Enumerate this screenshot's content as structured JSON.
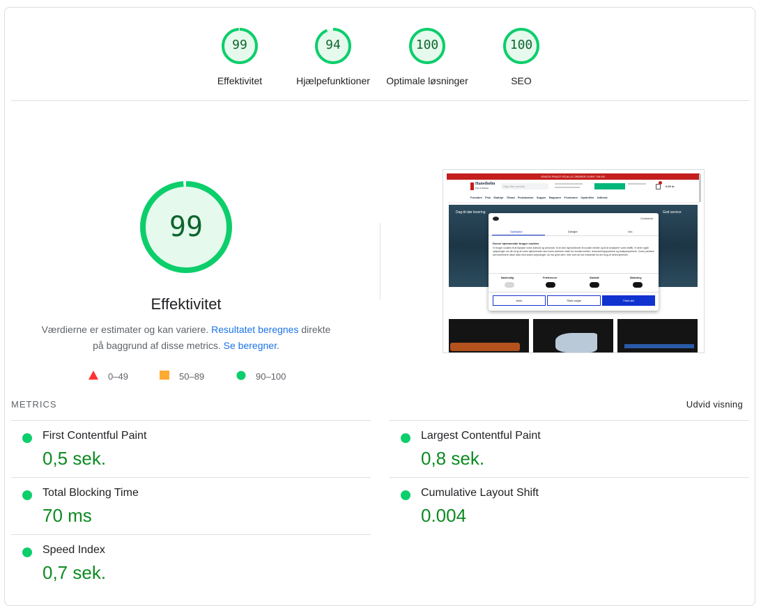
{
  "categories": [
    {
      "score": "99",
      "label": "Effektivitet",
      "value": 0.99
    },
    {
      "score": "94",
      "label": "Hjælpefunktioner",
      "value": 0.94
    },
    {
      "score": "100",
      "label": "Optimale løsninger",
      "value": 1.0
    },
    {
      "score": "100",
      "label": "SEO",
      "value": 1.0
    }
  ],
  "main": {
    "score": "99",
    "title": "Effektivitet",
    "desc_part1": "Værdierne er estimater og kan variere. ",
    "desc_link1": "Resultatet beregnes",
    "desc_part2": " direkte på baggrund af disse metrics. ",
    "desc_link2": "Se beregner",
    "desc_part3": "."
  },
  "legend": [
    {
      "range": "0–49",
      "shape": "triangle-icon",
      "color": "#ff3333"
    },
    {
      "range": "50–89",
      "shape": "square-icon",
      "color": "#ffaa33"
    },
    {
      "range": "90–100",
      "shape": "circle-icon",
      "color": "#0cce6b"
    }
  ],
  "colors": {
    "pass": "#0cce6b",
    "pass_text": "#0d652d",
    "pass_fill": "#e6f9ed"
  },
  "metrics_section": {
    "heading": "METRICS",
    "expand_label": "Udvid visning"
  },
  "metrics": [
    {
      "label": "First Contentful Paint",
      "value": "0,5 sek."
    },
    {
      "label": "Largest Contentful Paint",
      "value": "0,8 sek."
    },
    {
      "label": "Total Blocking Time",
      "value": "70 ms"
    },
    {
      "label": "Cumulative Layout Shift",
      "value": "0.004"
    },
    {
      "label": "Speed Index",
      "value": "0,7 sek."
    }
  ],
  "screenshot": {
    "banner": "GRATIS FRAGT PÅ ALLE ORDRER OVER 749 KR.",
    "logo": "Hanstholm",
    "logo_sub": "Fisk & Skaldyr",
    "search_placeholder": "Søg efter produkt",
    "nav": [
      "Forsiden",
      "Fisk",
      "Skaldyr",
      "Tilbud",
      "Fiskekasser",
      "Supper",
      "Røgvarer",
      "Frostvarer",
      "Opskrifter",
      "Udforsk"
    ],
    "hero_left": "Dag-til-dør levering",
    "hero_right": "God service",
    "dialog_brand": "Cookiebot",
    "dialog_tabs": [
      "Samtykke",
      "Detaljer",
      "Om"
    ],
    "dialog_heading": "Denne hjemmeside bruger cookies",
    "dialog_text": "Vi bruger cookies til at tilpasse vores indhold og annoncer, til at vise dig funktioner til sociale medier og til at analysere vores traffik. Vi deler også oplysninger om din brug af vores hjemmeside med vores partnere inden for sociale medier, annonceringspartnere og analysepartnere. Vores partnere kan kombinere disse data med andre oplysninger, du har givet dem, eller som de har indsamlet fra din brug af deres tjenester.",
    "toggles": [
      "Nødvendig",
      "Præferencer",
      "Statistik",
      "Marketing"
    ],
    "buttons": [
      "Afvis",
      "Tillad valgte",
      "Tillad alle"
    ],
    "cart": "0,00 kr."
  }
}
